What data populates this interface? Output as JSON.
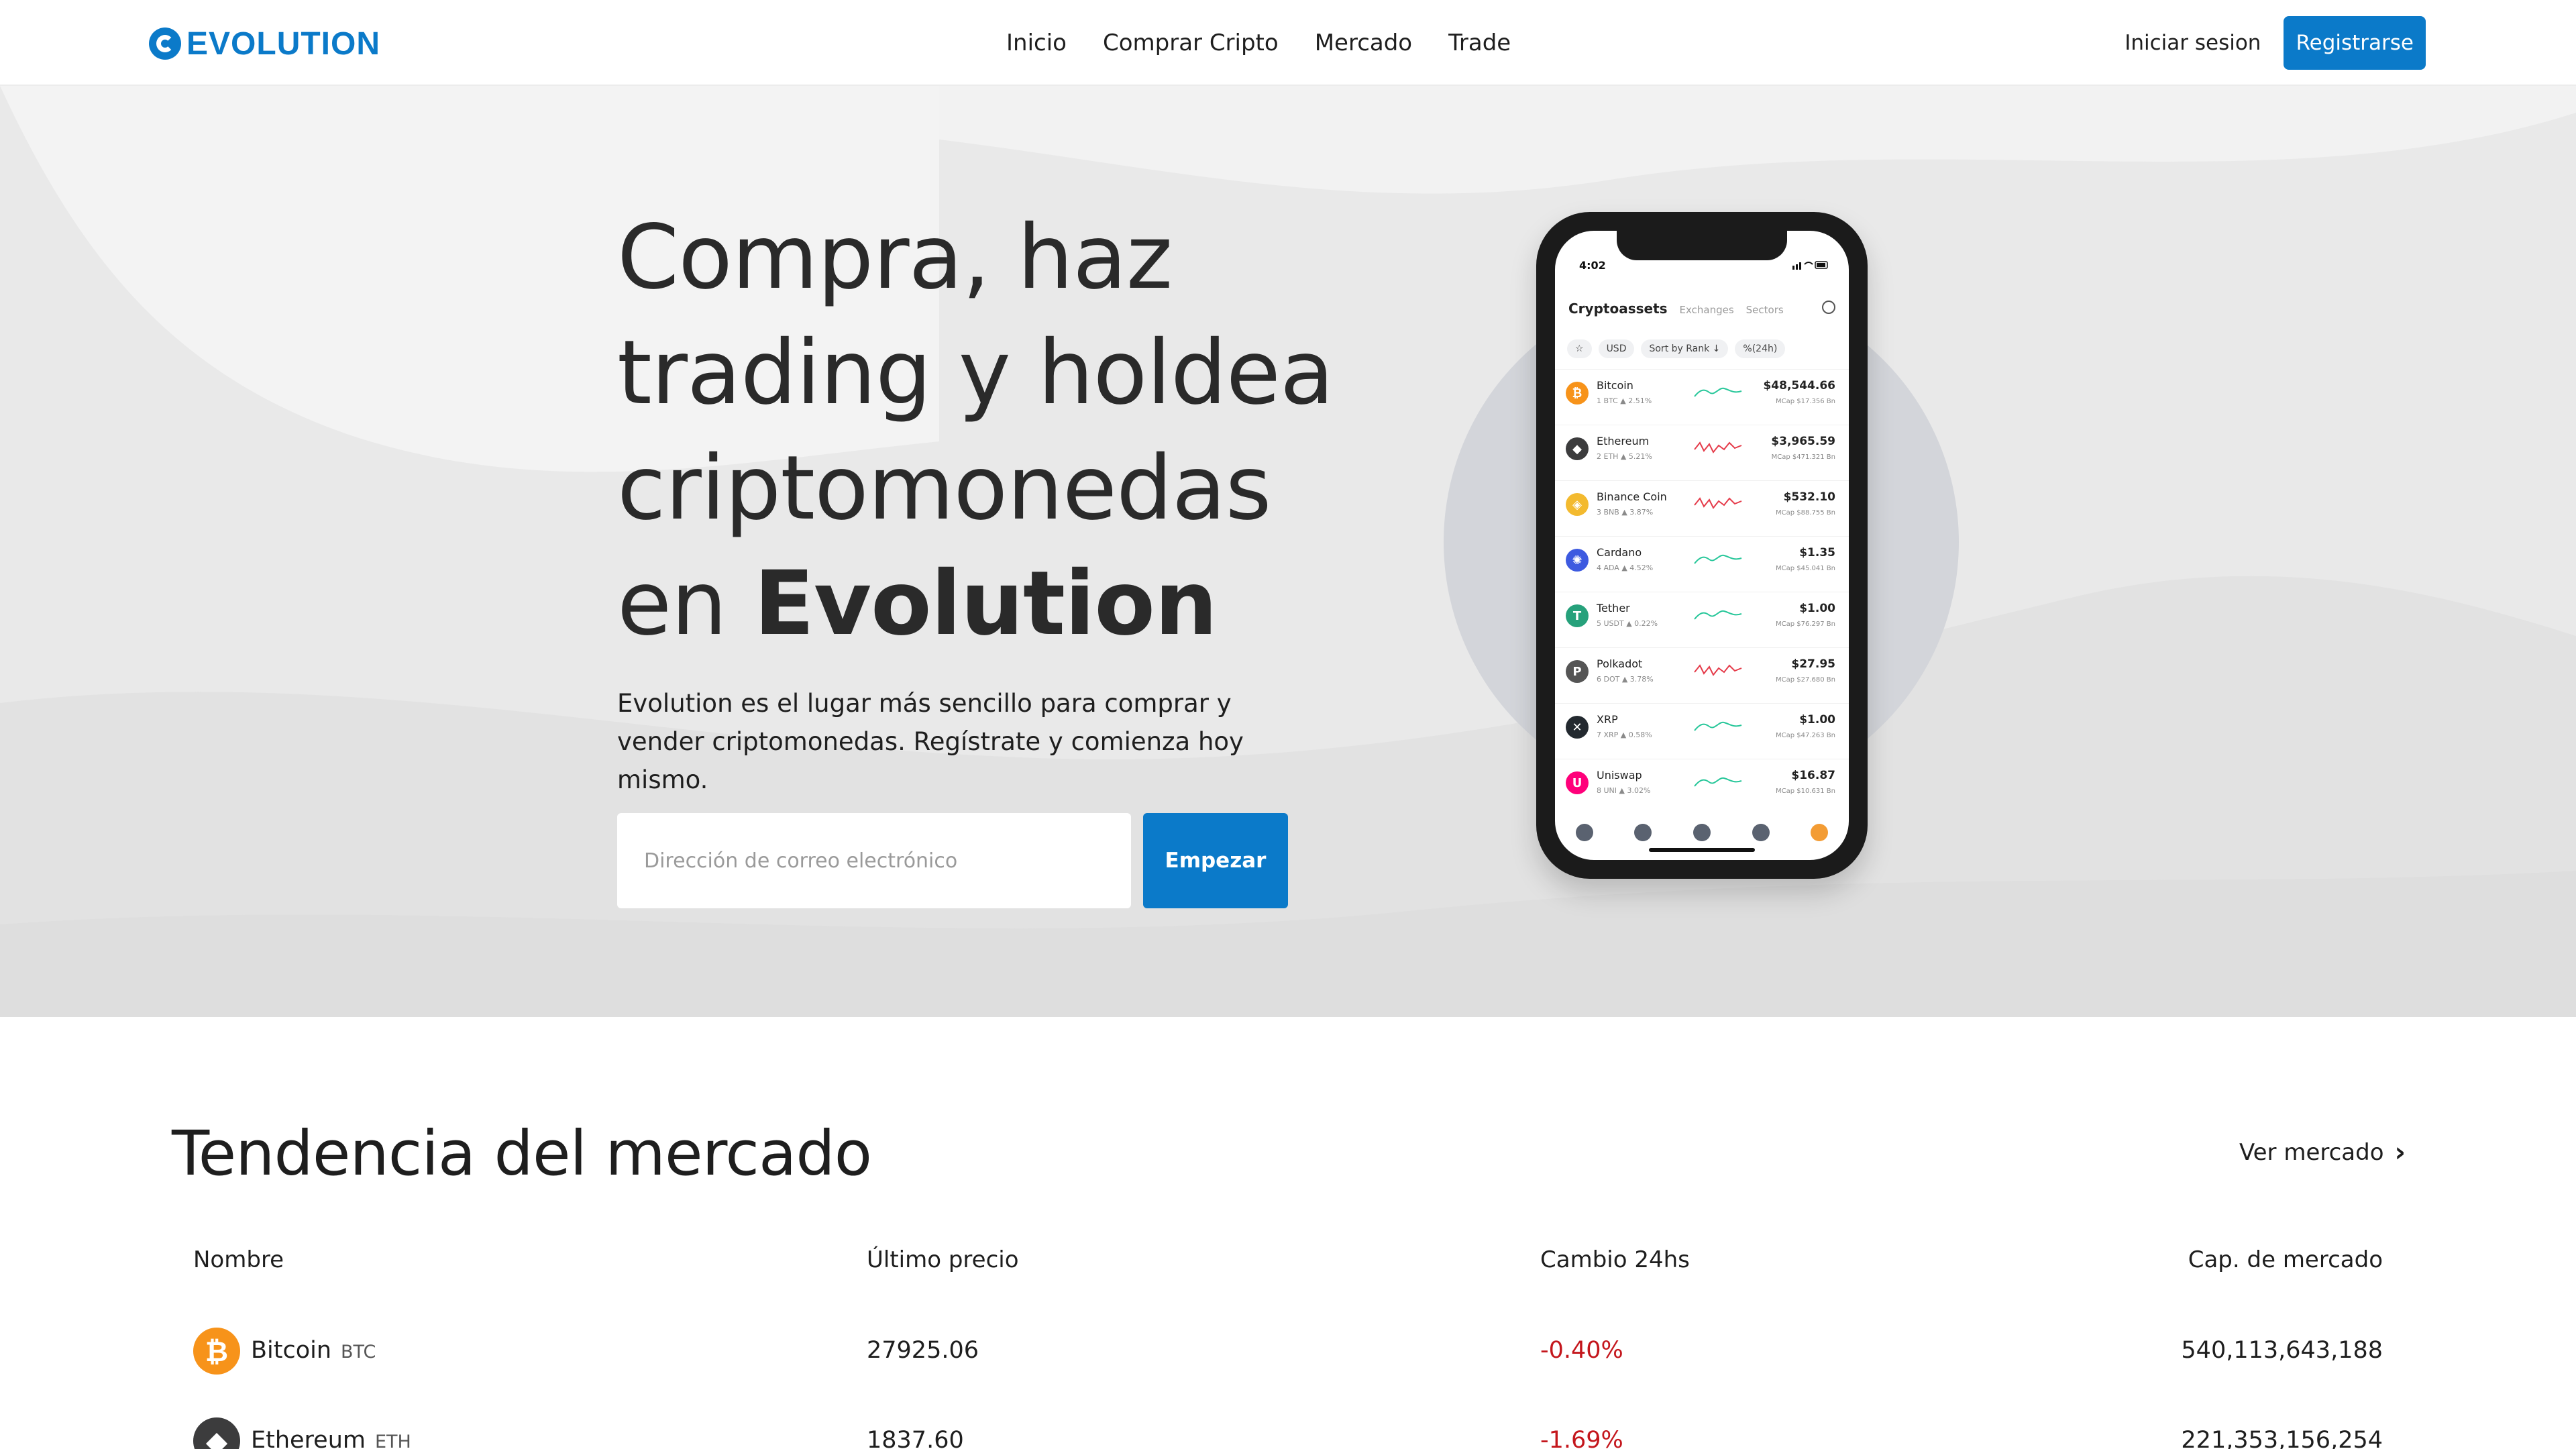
{
  "nav": {
    "logo": "EVOLUTION",
    "links": [
      "Inicio",
      "Comprar Cripto",
      "Mercado",
      "Trade"
    ],
    "login": "Iniciar sesion",
    "register": "Registrarse"
  },
  "hero": {
    "title_part1": "Compra, haz trading y holdea criptomonedas en ",
    "title_brand": "Evolution",
    "subtitle": "Evolution es el lugar más sencillo para comprar y vender criptomonedas. Regístrate y comienza hoy mismo.",
    "email_placeholder": "Dirección de correo electrónico",
    "cta": "Empezar"
  },
  "phone": {
    "time": "4:02",
    "tab_active": "Cryptoassets",
    "tabs": [
      "Exchanges",
      "Sectors"
    ],
    "filters": [
      "USD",
      "Sort by Rank ↓",
      "%(24h)"
    ],
    "rows": [
      {
        "name": "Bitcoin",
        "meta": "1  BTC  ▲ 2.51%",
        "price": "$48,544.66",
        "mcap": "MCap $17.356 Bn",
        "color": "#f7931a",
        "glyph": "₿",
        "trend": "up"
      },
      {
        "name": "Ethereum",
        "meta": "2  ETH  ▲ 5.21%",
        "price": "$3,965.59",
        "mcap": "MCap $471.321 Bn",
        "color": "#3c3c3d",
        "glyph": "◆",
        "trend": "down"
      },
      {
        "name": "Binance Coin",
        "meta": "3  BNB  ▲ 3.87%",
        "price": "$532.10",
        "mcap": "MCap $88.755 Bn",
        "color": "#f3ba2f",
        "glyph": "◈",
        "trend": "down"
      },
      {
        "name": "Cardano",
        "meta": "4  ADA  ▲ 4.52%",
        "price": "$1.35",
        "mcap": "MCap $45.041 Bn",
        "color": "#3d5ae0",
        "glyph": "✺",
        "trend": "up"
      },
      {
        "name": "Tether",
        "meta": "5  USDT  ▲ 0.22%",
        "price": "$1.00",
        "mcap": "MCap $76.297 Bn",
        "color": "#26a17b",
        "glyph": "T",
        "trend": "up"
      },
      {
        "name": "Polkadot",
        "meta": "6  DOT  ▲ 3.78%",
        "price": "$27.95",
        "mcap": "MCap $27.680 Bn",
        "color": "#555555",
        "glyph": "P",
        "trend": "down"
      },
      {
        "name": "XRP",
        "meta": "7  XRP  ▲ 0.58%",
        "price": "$1.00",
        "mcap": "MCap $47.263 Bn",
        "color": "#23292f",
        "glyph": "✕",
        "trend": "up"
      },
      {
        "name": "Uniswap",
        "meta": "8  UNI  ▲ 3.02%",
        "price": "$16.87",
        "mcap": "MCap $10.631 Bn",
        "color": "#ff007a",
        "glyph": "U",
        "trend": "up"
      }
    ]
  },
  "market": {
    "title": "Tendencia del mercado",
    "see_more": "Ver mercado",
    "headers": {
      "name": "Nombre",
      "price": "Último precio",
      "change": "Cambio 24hs",
      "cap": "Cap. de mercado"
    },
    "rows": [
      {
        "name": "Bitcoin",
        "symbol": "BTC",
        "price": "27925.06",
        "change": "-0.40%",
        "cap": "540,113,643,188",
        "color": "#f7931a",
        "glyph": "₿"
      },
      {
        "name": "Ethereum",
        "symbol": "ETH",
        "price": "1837.60",
        "change": "-1.69%",
        "cap": "221,353,156,254",
        "color": "#3c3c3d",
        "glyph": "◆"
      }
    ]
  },
  "colors": {
    "accent": "#0b7ac9",
    "negative": "#c4161c",
    "hero_bg": "#e9e9e9"
  }
}
